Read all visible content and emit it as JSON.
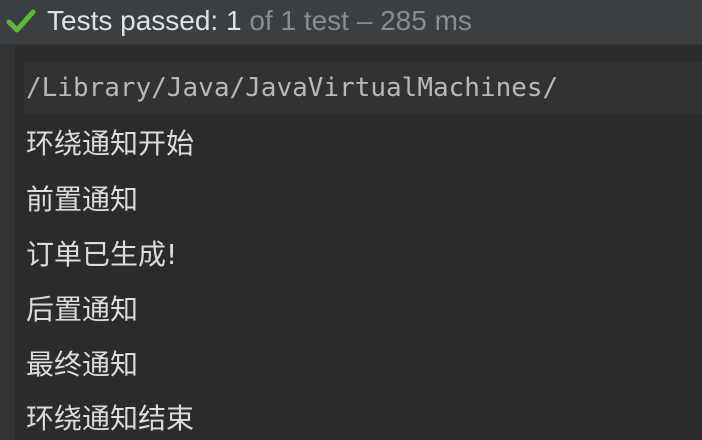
{
  "status": {
    "icon": "check-icon",
    "icon_color": "#5fb832",
    "label": "Tests passed:",
    "passed": "1",
    "rest": "of 1 test – 285 ms"
  },
  "console": {
    "path": "/Library/Java/JavaVirtualMachines/",
    "lines": [
      "环绕通知开始",
      "前置通知",
      "订单已生成!",
      "后置通知",
      "最终通知",
      "环绕通知结束"
    ]
  }
}
